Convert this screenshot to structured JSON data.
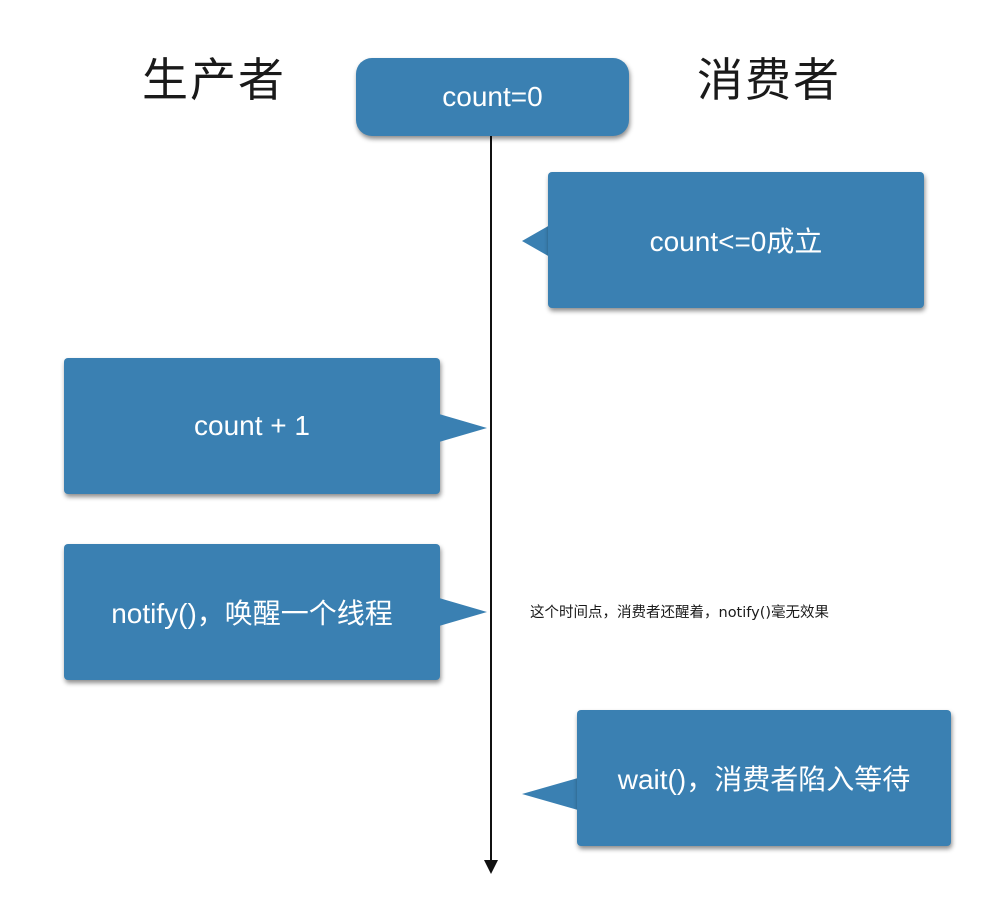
{
  "headings": {
    "producer": "生产者",
    "consumer": "消费者"
  },
  "start": {
    "label": "count=0"
  },
  "events": [
    {
      "side": "consumer",
      "label": "count<=0成立"
    },
    {
      "side": "producer",
      "label": "count + 1"
    },
    {
      "side": "producer",
      "label": "notify()，唤醒一个线程"
    },
    {
      "side": "consumer",
      "label": "wait()，消费者陷入等待"
    }
  ],
  "note": "这个时间点，消费者还醒着，notify()毫无效果",
  "colors": {
    "box": "#3a80b2",
    "box_text": "#ffffff",
    "line": "#111111"
  }
}
